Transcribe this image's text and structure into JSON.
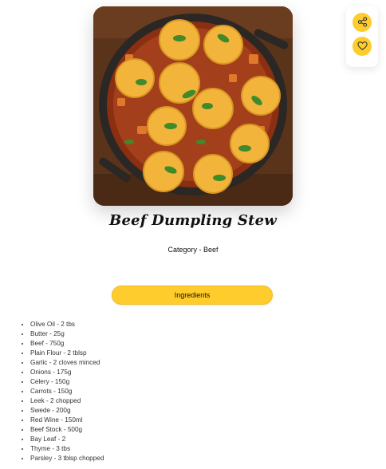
{
  "recipe": {
    "title": "Beef Dumpling Stew",
    "category": "Category - Beef"
  },
  "actions": {
    "share_icon": "share-icon",
    "favorite_icon": "heart-icon"
  },
  "ingredients_button": {
    "label": "Ingredients"
  },
  "ingredients": [
    "Olive Oil - 2 tbs",
    "Butter - 25g",
    "Beef - 750g",
    "Plain Flour - 2 tblsp",
    "Garlic - 2 cloves minced",
    "Onions - 175g",
    "Celery - 150g",
    "Carrots - 150g",
    "Leek - 2 chopped",
    "Swede - 200g",
    "Red Wine - 150ml",
    "Beef Stock - 500g",
    "Bay Leaf - 2",
    "Thyme - 3 tbs",
    "Parsley - 3 tblsp chopped"
  ],
  "colors": {
    "accent": "#ffcc2e",
    "text": "#111111"
  }
}
